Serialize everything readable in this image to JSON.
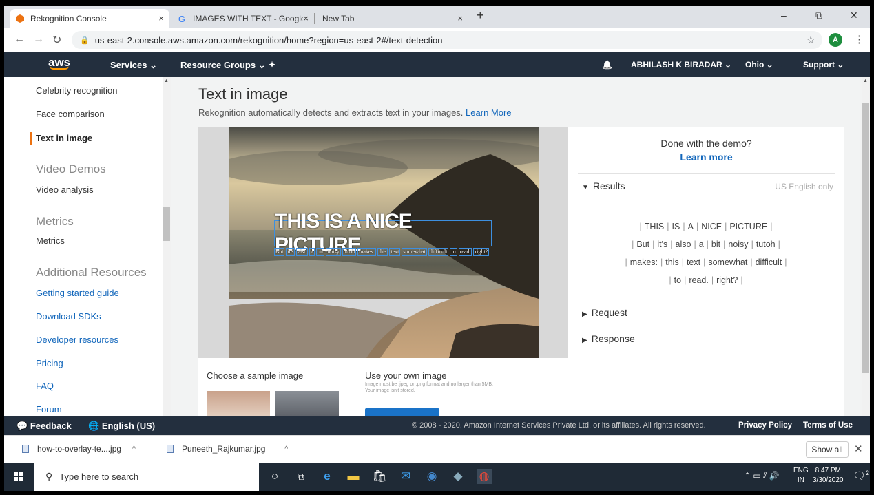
{
  "browser": {
    "tabs": [
      {
        "label": "Rekognition Console",
        "active": true
      },
      {
        "label": "IMAGES WITH TEXT - Google Sea",
        "active": false
      },
      {
        "label": "New Tab",
        "active": false
      }
    ],
    "new_tab_symbol": "+",
    "close_symbol": "×",
    "window_controls": {
      "minimize": "–",
      "restore": "⧉",
      "close": "✕"
    },
    "url": "us-east-2.console.aws.amazon.com/rekognition/home?region=us-east-2#/text-detection",
    "profile_initial": "A"
  },
  "aws_nav": {
    "logo": "aws",
    "services": "Services ⌄",
    "resource_groups": "Resource Groups ⌄",
    "pin": "✦",
    "bell": "🔔",
    "user": "ABHILASH K BIRADAR ⌄",
    "region": "Ohio ⌄",
    "support": "Support ⌄"
  },
  "sidebar": {
    "items": [
      {
        "label": "Celebrity recognition",
        "type": "item"
      },
      {
        "label": "Face comparison",
        "type": "item"
      },
      {
        "label": "Text in image",
        "type": "active"
      },
      {
        "label": "Video Demos",
        "type": "head"
      },
      {
        "label": "Video analysis",
        "type": "item"
      },
      {
        "label": "Metrics",
        "type": "head"
      },
      {
        "label": "Metrics",
        "type": "item"
      },
      {
        "label": "Additional Resources",
        "type": "head"
      },
      {
        "label": "Getting started guide",
        "type": "link"
      },
      {
        "label": "Download SDKs",
        "type": "link"
      },
      {
        "label": "Developer resources",
        "type": "link"
      },
      {
        "label": "Pricing",
        "type": "link"
      },
      {
        "label": "FAQ",
        "type": "link"
      },
      {
        "label": "Forum",
        "type": "link"
      }
    ]
  },
  "main": {
    "title": "Text in image",
    "subtitle": "Rekognition automatically detects and extracts text in your images.",
    "learn_more": "Learn More",
    "image_text_big": "THIS IS A NICE PICTURE",
    "image_text_small": [
      "But",
      "it's",
      "also",
      "a",
      "bit",
      "noisy",
      "tutoh",
      "makes:",
      "this",
      "text",
      "somewhat",
      "difficult",
      "to",
      "read.",
      "right?"
    ],
    "choose_sample": "Choose a sample image",
    "use_own": "Use your own image",
    "own_note": "Image must be .jpeg or .png format and no larger than 5MB. Your image isn't stored."
  },
  "results_panel": {
    "done": "Done with the demo?",
    "learn_more": "Learn more",
    "results_label": "Results",
    "us_english": "US English only",
    "detected_lines": [
      [
        "THIS",
        "IS",
        "A",
        "NICE",
        "PICTURE"
      ],
      [
        "But",
        "it's",
        "also",
        "a",
        "bit",
        "noisy",
        "tutoh"
      ],
      [
        "makes:",
        "this",
        "text",
        "somewhat",
        "difficult"
      ],
      [
        "to",
        "read.",
        "right?"
      ]
    ],
    "request_label": "Request",
    "response_label": "Response"
  },
  "footer": {
    "feedback": "Feedback",
    "language": "English (US)",
    "copyright": "© 2008 - 2020, Amazon Internet Services Private Ltd. or its affiliates. All rights reserved.",
    "privacy": "Privacy Policy",
    "terms": "Terms of Use"
  },
  "downloads": {
    "files": [
      "how-to-overlay-te....jpg",
      "Puneeth_Rajkumar.jpg"
    ],
    "show_all": "Show all"
  },
  "taskbar": {
    "search_placeholder": "Type here to search",
    "lang_top": "ENG",
    "lang_bottom": "IN",
    "time": "8:47 PM",
    "date": "3/30/2020",
    "notifications": "2"
  },
  "colors": {
    "aws_nav": "#232f3e",
    "accent_orange": "#ec7211",
    "link_blue": "#1166bb",
    "box_blue": "#3d8fe0"
  }
}
